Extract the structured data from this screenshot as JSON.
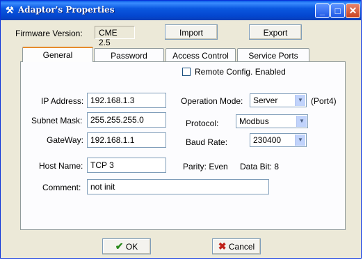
{
  "window": {
    "title": "Adaptor's Properties",
    "minimize": "_",
    "maximize": "□",
    "close": "✕"
  },
  "header": {
    "firmware_label": "Firmware Version:",
    "firmware_value": "CME 2.5",
    "import_label": "Import",
    "export_label": "Export"
  },
  "tabs": [
    {
      "label": "General",
      "active": true
    },
    {
      "label": "Password",
      "active": false
    },
    {
      "label": "Access Control",
      "active": false
    },
    {
      "label": "Service Ports",
      "active": false
    }
  ],
  "general": {
    "remote_config": {
      "label": "Remote Config. Enabled",
      "checked": false
    },
    "ip": {
      "label": "IP Address:",
      "value": "192.168.1.3"
    },
    "subnet": {
      "label": "Subnet Mask:",
      "value": "255.255.255.0"
    },
    "gateway": {
      "label": "GateWay:",
      "value": "192.168.1.1"
    },
    "host": {
      "label": "Host Name:",
      "value": "TCP 3"
    },
    "comment": {
      "label": "Comment:",
      "value": "not init"
    },
    "operation_mode": {
      "label": "Operation Mode:",
      "value": "Server",
      "suffix": "(Port4)"
    },
    "protocol": {
      "label": "Protocol:",
      "value": "Modbus"
    },
    "baud_rate": {
      "label": "Baud Rate:",
      "value": "230400"
    },
    "parity": "Parity: Even",
    "data_bit": "Data Bit: 8"
  },
  "footer": {
    "ok_label": "OK",
    "cancel_label": "Cancel"
  },
  "colors": {
    "titlebar": "#0b58e0",
    "dialog_bg": "#ece9d8",
    "active_tab_accent": "#e68b2c",
    "ok_check": "#2a8a1c",
    "cancel_x": "#c0221a"
  }
}
